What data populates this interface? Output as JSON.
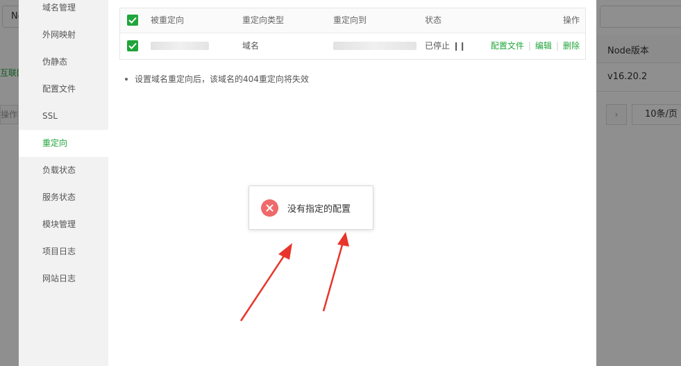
{
  "background": {
    "filter_tab_label": "No",
    "left_link_text": "互联网",
    "left_op_label": "操作",
    "right_column_header": "Node版本",
    "right_cell_value": "v16.20.2",
    "page_size_label": "10条/页",
    "next_icon": "chevron-right-icon"
  },
  "sidebar": {
    "items": [
      {
        "label": "域名管理"
      },
      {
        "label": "外网映射"
      },
      {
        "label": "伪静态"
      },
      {
        "label": "配置文件"
      },
      {
        "label": "SSL"
      },
      {
        "label": "重定向"
      },
      {
        "label": "负载状态"
      },
      {
        "label": "服务状态"
      },
      {
        "label": "模块管理"
      },
      {
        "label": "项目日志"
      },
      {
        "label": "网站日志"
      }
    ],
    "active_index": 5
  },
  "table": {
    "columns": [
      "被重定向",
      "重定向类型",
      "重定向到",
      "状态",
      "操作"
    ],
    "rows": [
      {
        "redirect_type": "域名",
        "status": "已停止",
        "status_icon": "pause-icon",
        "actions": [
          "配置文件",
          "编辑",
          "删除"
        ]
      }
    ]
  },
  "tip": "设置域名重定向后，该域名的404重定向将失效",
  "toast": {
    "message": "没有指定的配置",
    "icon": "error-x-icon"
  },
  "colors": {
    "accent_green": "#20a53a",
    "status_red": "#e00000",
    "toast_icon_red": "#ef6a6a",
    "annotation_arrow_red": "#e8342a"
  }
}
